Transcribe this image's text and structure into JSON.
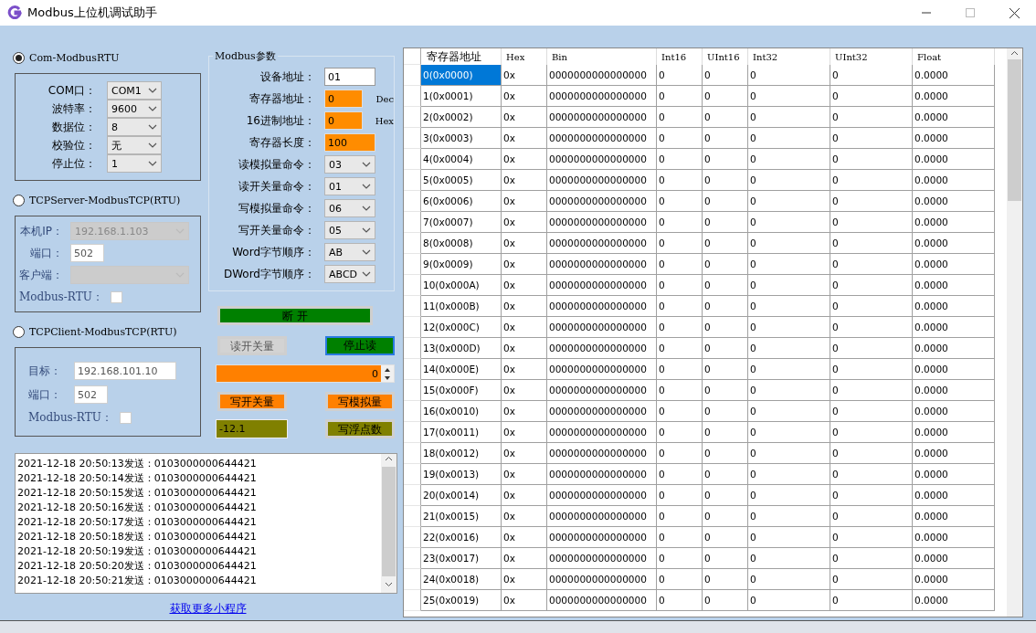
{
  "window": {
    "title": "Modbus上位机调试助手"
  },
  "serial": {
    "mode": {
      "label": "Com-ModbusRTU",
      "selected": true
    },
    "fields": [
      {
        "label": "COM口：",
        "value": "COM1"
      },
      {
        "label": "波特率：",
        "value": "9600"
      },
      {
        "label": "数据位：",
        "value": "8"
      },
      {
        "label": "校验位：",
        "value": "无"
      },
      {
        "label": "停止位：",
        "value": "1"
      }
    ]
  },
  "tcp_server": {
    "mode": {
      "label": "TCPServer-ModbusTCP(RTU)",
      "selected": false
    },
    "ip": {
      "label": "本机IP：",
      "value": "192.168.1.103",
      "disabled": true
    },
    "port": {
      "label": "端口：",
      "value": "502"
    },
    "client": {
      "label": "客户端：",
      "disabled": true
    },
    "rtu": {
      "label": "Modbus-RTU：",
      "checked": false
    }
  },
  "tcp_client": {
    "mode": {
      "label": "TCPClient-ModbusTCP(RTU)",
      "selected": false
    },
    "fields": [
      {
        "label": "目标：",
        "value": "192.168.101.10"
      },
      {
        "label": "端口：",
        "value": "502"
      }
    ],
    "rtu": {
      "label": "Modbus-RTU：",
      "checked": false
    }
  },
  "params": {
    "title": "Modbus参数",
    "fields": [
      {
        "kind": "input",
        "label": "设备地址：",
        "value": "01",
        "highlighted": false
      },
      {
        "kind": "input",
        "label": "寄存器地址：",
        "value": "0",
        "highlighted": true,
        "unit": "Dec"
      },
      {
        "kind": "input",
        "label": "16进制地址：",
        "value": "0",
        "highlighted": true,
        "unit": "Hex"
      },
      {
        "kind": "input",
        "label": "寄存器长度：",
        "value": "100",
        "highlighted": true
      },
      {
        "kind": "select",
        "label": "读模拟量命令：",
        "value": "03"
      },
      {
        "kind": "select",
        "label": "读开关量命令：",
        "value": "01"
      },
      {
        "kind": "select",
        "label": "写模拟量命令：",
        "value": "06"
      },
      {
        "kind": "select",
        "label": "写开关量命令：",
        "value": "05"
      },
      {
        "kind": "select",
        "label": "Word字节顺序：",
        "value": "AB"
      },
      {
        "kind": "select",
        "label": "DWord字节顺序：",
        "value": "ABCD"
      }
    ]
  },
  "connect_button": {
    "label": "断 开",
    "color": "#008000"
  },
  "read_buttons": [
    {
      "label": "读开关量",
      "color": "#d3d3d3",
      "focused": false
    },
    {
      "label": "停止读",
      "color": "#008000",
      "focused": true
    }
  ],
  "spinner": {
    "value": "0"
  },
  "write_buttons": [
    {
      "label": "写开关量",
      "color": "#ff8000",
      "focused": false
    },
    {
      "label": "写模拟量",
      "color": "#ff8000",
      "focused": false
    }
  ],
  "float_input": {
    "value": "-12.1"
  },
  "float_button": {
    "label": "写浮点数",
    "color": "#808000",
    "focused": false
  },
  "log": {
    "lines": [
      "2021-12-18 20:50:13发送：0103000000644421",
      "2021-12-18 20:50:14发送：0103000000644421",
      "2021-12-18 20:50:15发送：0103000000644421",
      "2021-12-18 20:50:16发送：0103000000644421",
      "2021-12-18 20:50:17发送：0103000000644421",
      "2021-12-18 20:50:18发送：0103000000644421",
      "2021-12-18 20:50:19发送：0103000000644421",
      "2021-12-18 20:50:20发送：0103000000644421",
      "2021-12-18 20:50:21发送：0103000000644421"
    ]
  },
  "link": "获取更多小程序",
  "table": {
    "columns": [
      "寄存器地址",
      "Hex",
      "Bin",
      "Int16",
      "UInt16",
      "Int32",
      "UInt32",
      "Float"
    ],
    "rows": [
      {
        "selected": true,
        "cells": [
          "0(0x0000)",
          "0x",
          "0000000000000000",
          "0",
          "0",
          "0",
          "0",
          "0.0000"
        ]
      },
      {
        "selected": false,
        "cells": [
          "1(0x0001)",
          "0x",
          "0000000000000000",
          "0",
          "0",
          "0",
          "0",
          "0.0000"
        ]
      },
      {
        "selected": false,
        "cells": [
          "2(0x0002)",
          "0x",
          "0000000000000000",
          "0",
          "0",
          "0",
          "0",
          "0.0000"
        ]
      },
      {
        "selected": false,
        "cells": [
          "3(0x0003)",
          "0x",
          "0000000000000000",
          "0",
          "0",
          "0",
          "0",
          "0.0000"
        ]
      },
      {
        "selected": false,
        "cells": [
          "4(0x0004)",
          "0x",
          "0000000000000000",
          "0",
          "0",
          "0",
          "0",
          "0.0000"
        ]
      },
      {
        "selected": false,
        "cells": [
          "5(0x0005)",
          "0x",
          "0000000000000000",
          "0",
          "0",
          "0",
          "0",
          "0.0000"
        ]
      },
      {
        "selected": false,
        "cells": [
          "6(0x0006)",
          "0x",
          "0000000000000000",
          "0",
          "0",
          "0",
          "0",
          "0.0000"
        ]
      },
      {
        "selected": false,
        "cells": [
          "7(0x0007)",
          "0x",
          "0000000000000000",
          "0",
          "0",
          "0",
          "0",
          "0.0000"
        ]
      },
      {
        "selected": false,
        "cells": [
          "8(0x0008)",
          "0x",
          "0000000000000000",
          "0",
          "0",
          "0",
          "0",
          "0.0000"
        ]
      },
      {
        "selected": false,
        "cells": [
          "9(0x0009)",
          "0x",
          "0000000000000000",
          "0",
          "0",
          "0",
          "0",
          "0.0000"
        ]
      },
      {
        "selected": false,
        "cells": [
          "10(0x000A)",
          "0x",
          "0000000000000000",
          "0",
          "0",
          "0",
          "0",
          "0.0000"
        ]
      },
      {
        "selected": false,
        "cells": [
          "11(0x000B)",
          "0x",
          "0000000000000000",
          "0",
          "0",
          "0",
          "0",
          "0.0000"
        ]
      },
      {
        "selected": false,
        "cells": [
          "12(0x000C)",
          "0x",
          "0000000000000000",
          "0",
          "0",
          "0",
          "0",
          "0.0000"
        ]
      },
      {
        "selected": false,
        "cells": [
          "13(0x000D)",
          "0x",
          "0000000000000000",
          "0",
          "0",
          "0",
          "0",
          "0.0000"
        ]
      },
      {
        "selected": false,
        "cells": [
          "14(0x000E)",
          "0x",
          "0000000000000000",
          "0",
          "0",
          "0",
          "0",
          "0.0000"
        ]
      },
      {
        "selected": false,
        "cells": [
          "15(0x000F)",
          "0x",
          "0000000000000000",
          "0",
          "0",
          "0",
          "0",
          "0.0000"
        ]
      },
      {
        "selected": false,
        "cells": [
          "16(0x0010)",
          "0x",
          "0000000000000000",
          "0",
          "0",
          "0",
          "0",
          "0.0000"
        ]
      },
      {
        "selected": false,
        "cells": [
          "17(0x0011)",
          "0x",
          "0000000000000000",
          "0",
          "0",
          "0",
          "0",
          "0.0000"
        ]
      },
      {
        "selected": false,
        "cells": [
          "18(0x0012)",
          "0x",
          "0000000000000000",
          "0",
          "0",
          "0",
          "0",
          "0.0000"
        ]
      },
      {
        "selected": false,
        "cells": [
          "19(0x0013)",
          "0x",
          "0000000000000000",
          "0",
          "0",
          "0",
          "0",
          "0.0000"
        ]
      },
      {
        "selected": false,
        "cells": [
          "20(0x0014)",
          "0x",
          "0000000000000000",
          "0",
          "0",
          "0",
          "0",
          "0.0000"
        ]
      },
      {
        "selected": false,
        "cells": [
          "21(0x0015)",
          "0x",
          "0000000000000000",
          "0",
          "0",
          "0",
          "0",
          "0.0000"
        ]
      },
      {
        "selected": false,
        "cells": [
          "22(0x0016)",
          "0x",
          "0000000000000000",
          "0",
          "0",
          "0",
          "0",
          "0.0000"
        ]
      },
      {
        "selected": false,
        "cells": [
          "23(0x0017)",
          "0x",
          "0000000000000000",
          "0",
          "0",
          "0",
          "0",
          "0.0000"
        ]
      },
      {
        "selected": false,
        "cells": [
          "24(0x0018)",
          "0x",
          "0000000000000000",
          "0",
          "0",
          "0",
          "0",
          "0.0000"
        ]
      },
      {
        "selected": false,
        "cells": [
          "25(0x0019)",
          "0x",
          "0000000000000000",
          "0",
          "0",
          "0",
          "0",
          "0.0000"
        ]
      }
    ]
  }
}
